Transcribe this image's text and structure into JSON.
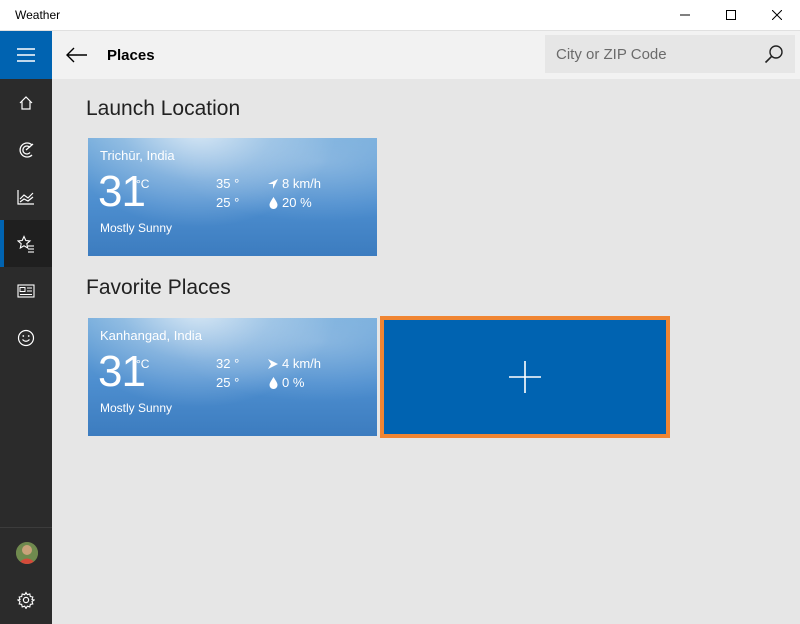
{
  "window": {
    "title": "Weather"
  },
  "header": {
    "page_title": "Places",
    "search_placeholder": "City or ZIP Code"
  },
  "sidebar": {
    "items": [
      {
        "icon": "home-icon"
      },
      {
        "icon": "forecast-icon"
      },
      {
        "icon": "historical-chart-icon"
      },
      {
        "icon": "places-star-icon",
        "active": true
      },
      {
        "icon": "news-icon"
      },
      {
        "icon": "feedback-smiley-icon"
      }
    ],
    "bottom": [
      {
        "icon": "avatar"
      },
      {
        "icon": "gear-icon"
      }
    ]
  },
  "launch_location": {
    "title": "Launch Location",
    "tile": {
      "location": "Trichūr, India",
      "temp": "31",
      "unit": "°C",
      "high": "35 °",
      "low": "25 °",
      "wind": "8 km/h",
      "precip": "20 %",
      "condition": "Mostly Sunny"
    }
  },
  "favorite_places": {
    "title": "Favorite Places",
    "tiles": [
      {
        "location": "Kanhangad, India",
        "temp": "31",
        "unit": "°C",
        "high": "32 °",
        "low": "25 °",
        "wind": "4 km/h",
        "precip": "0 %",
        "condition": "Mostly Sunny"
      }
    ],
    "add_icon": "plus-icon"
  },
  "colors": {
    "accent": "#0063b1",
    "focus_border": "#f08532",
    "sidebar_bg": "#2b2b2b",
    "content_bg": "#e6e6e6"
  }
}
